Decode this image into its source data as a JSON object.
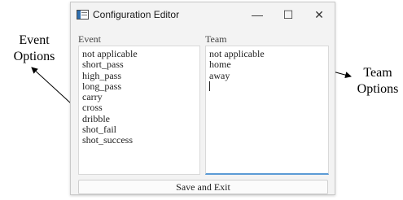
{
  "annotations": {
    "event_options": "Event Options",
    "team_options": "Team Options"
  },
  "window": {
    "title": "Configuration Editor",
    "icon": "app-window-icon",
    "controls": {
      "minimize": "—",
      "maximize": "☐",
      "close": "✕"
    }
  },
  "event": {
    "label": "Event",
    "items": [
      "not applicable",
      "short_pass",
      "high_pass",
      "long_pass",
      "carry",
      "cross",
      "dribble",
      "shot_fail",
      "shot_success"
    ]
  },
  "team": {
    "label": "Team",
    "items": [
      "not applicable",
      "home",
      "away"
    ],
    "cursor_line": ""
  },
  "save_button": "Save and Exit",
  "colors": {
    "focus_accent": "#5b9bd5",
    "window_bg": "#f3f3f3"
  }
}
